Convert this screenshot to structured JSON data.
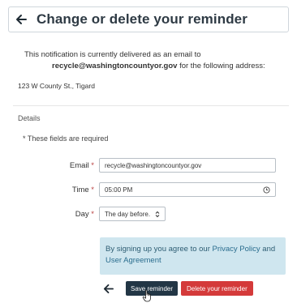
{
  "header": {
    "title": "Change or delete your reminder"
  },
  "notice": {
    "line1": "This notification is currently delivered as an email to",
    "email": "recycle@washingtoncountyor.gov",
    "line2_suffix": " for the following address:"
  },
  "address": "123 W County St., Tigard",
  "details": {
    "heading": "Details",
    "required_note": "* These fields are required"
  },
  "form": {
    "email_label": "Email",
    "email_value": "recycle@washingtoncountyor.gov",
    "time_label": "Time",
    "time_value": "05:00 PM",
    "day_label": "Day",
    "day_value": "The day before.",
    "required_marker": "*"
  },
  "info": {
    "prefix": "By signing up you agree to our ",
    "privacy_link": "Privacy Policy",
    "and_text": " and ",
    "agreement_link": "User Agreement"
  },
  "actions": {
    "save_label": "Save reminder",
    "delete_label": "Delete your reminder"
  },
  "icons": {
    "back": "arrow-left-icon",
    "clock": "clock-icon",
    "select": "updown-chevron-icon",
    "cursor": "hand-pointer-icon"
  }
}
